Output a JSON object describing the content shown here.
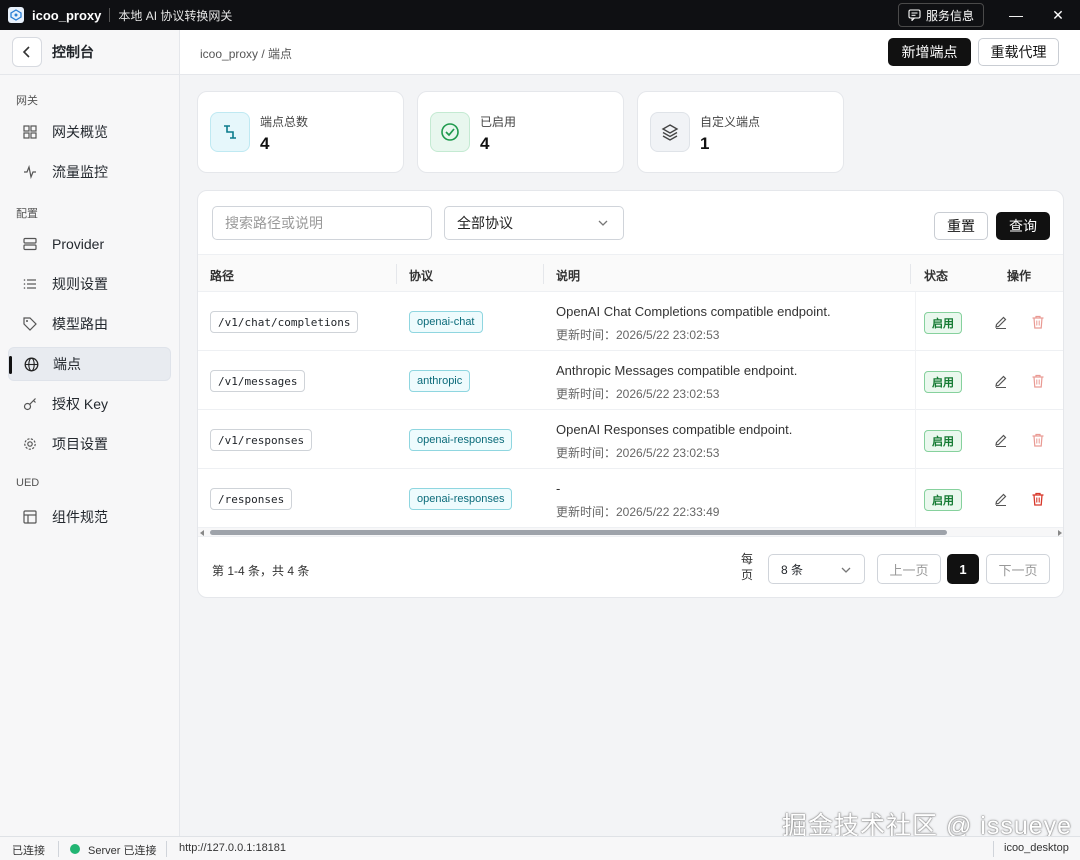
{
  "titlebar": {
    "app_name": "icoo_proxy",
    "subtitle": "本地 AI 协议转换网关",
    "service_label": "服务信息",
    "minimize": "—",
    "close": "✕"
  },
  "sidebar": {
    "title": "控制台",
    "groups": {
      "gateway": "网关",
      "config": "配置",
      "ued": "UED"
    },
    "items": [
      {
        "label": "网关概览",
        "icon": "grid-icon"
      },
      {
        "label": "流量监控",
        "icon": "activity-icon"
      },
      {
        "label": "Provider",
        "icon": "server-icon"
      },
      {
        "label": "规则设置",
        "icon": "list-icon"
      },
      {
        "label": "模型路由",
        "icon": "tag-icon"
      },
      {
        "label": "端点",
        "icon": "globe-icon",
        "active": true
      },
      {
        "label": "授权 Key",
        "icon": "key-icon"
      },
      {
        "label": "项目设置",
        "icon": "gear-icon"
      },
      {
        "label": "组件规范",
        "icon": "layout-icon"
      }
    ]
  },
  "header": {
    "breadcrumb": "icoo_proxy  /  端点",
    "new_endpoint": "新增端点",
    "reload_proxy": "重载代理"
  },
  "stats": [
    {
      "label": "端点总数",
      "value": "4",
      "icon": "route-icon",
      "color": "#e6f7fb"
    },
    {
      "label": "已启用",
      "value": "4",
      "icon": "check-circle-icon",
      "color": "#e8f7ee"
    },
    {
      "label": "自定义端点",
      "value": "1",
      "icon": "layers-icon",
      "color": "#f1f3f6"
    }
  ],
  "filters": {
    "search_placeholder": "搜索路径或说明",
    "protocol_selected": "全部协议",
    "reset": "重置",
    "query": "查询"
  },
  "table": {
    "columns": [
      "路径",
      "协议",
      "说明",
      "状态",
      "操作"
    ],
    "rows": [
      {
        "path": "/v1/chat/completions",
        "protocol": "openai-chat",
        "description": "OpenAI Chat Completions compatible endpoint.",
        "updated": "更新时间：2026/5/22 23:02:53",
        "status": "启用"
      },
      {
        "path": "/v1/messages",
        "protocol": "anthropic",
        "description": "Anthropic Messages compatible endpoint.",
        "updated": "更新时间：2026/5/22 23:02:53",
        "status": "启用"
      },
      {
        "path": "/v1/responses",
        "protocol": "openai-responses",
        "description": "OpenAI Responses compatible endpoint.",
        "updated": "更新时间：2026/5/22 23:02:53",
        "status": "启用"
      },
      {
        "path": "/responses",
        "protocol": "openai-responses",
        "description": "-",
        "updated": "更新时间：2026/5/22 22:33:49",
        "status": "启用"
      }
    ]
  },
  "pagination": {
    "total": "第 1-4 条，共 4 条",
    "per_page_label": "每页",
    "page_size": "8 条",
    "prev": "上一页",
    "current": "1",
    "next": "下一页"
  },
  "statusbar": {
    "connection": "已连接",
    "server": "Server 已连接",
    "url": "http://127.0.0.1:18181",
    "app": "icoo_desktop"
  },
  "watermark": "掘金技术社区 @ issueye",
  "colors": {
    "accent": "#111111",
    "status_green": "#147a32",
    "protocol_teal": "#0b6b7a",
    "danger": "#e05a4f"
  }
}
